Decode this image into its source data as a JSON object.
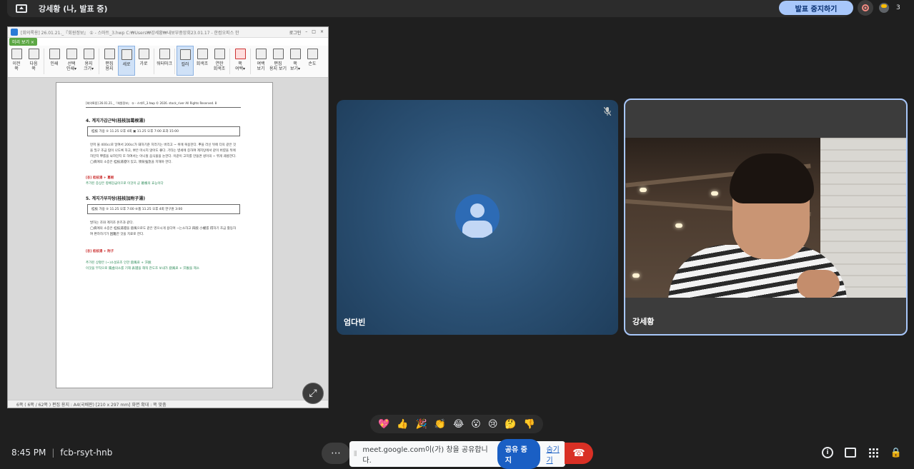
{
  "presentation_bar": {
    "title": "강세황 (나, 발표 중)",
    "stop_presenting_label": "발표 중지하기",
    "participant_count": "3"
  },
  "document_window": {
    "title_text": "[회의록용] 26.01.21._『회원정보』 ① - 스마트_3.hwp C:₩Users₩강세황₩내보부중앙회23.01.17 - 한컴오피스 한",
    "login_label": "로그인",
    "preview_tab": "미리 보기 ×",
    "toolbar": [
      {
        "label": "이전\n쪽",
        "sel": false
      },
      {
        "label": "다음\n쪽",
        "sel": false
      },
      {
        "label": "인쇄",
        "sel": false
      },
      {
        "label": "선택\n인쇄▾",
        "sel": false
      },
      {
        "label": "용지\n크기▾",
        "sel": false
      },
      {
        "label": "편집\n용지",
        "sel": false
      },
      {
        "label": "세로",
        "sel": true
      },
      {
        "label": "가로",
        "sel": false
      },
      {
        "label": "워터마크",
        "sel": false
      },
      {
        "label": "컬러",
        "sel": true
      },
      {
        "label": "회색조",
        "sel": false
      },
      {
        "label": "연한\n회색조",
        "sel": false
      },
      {
        "label": "쪽\n여백▾",
        "sel": false
      },
      {
        "label": "여백\n보기",
        "sel": false
      },
      {
        "label": "편집\n용지 보기",
        "sel": false
      },
      {
        "label": "쪽\n보기▾",
        "sel": false
      },
      {
        "label": "손도",
        "sel": false
      }
    ],
    "page": {
      "header": "[회의록용] 26.01.21._『회원정보』 ① - 스마트_3.hwp  © 2026. stock_river All Rights Reserved.      8",
      "section4_title": "4. 계지가감근탁(桂枝加葛根湯)",
      "section4_box": "桂枝 가용  ⑤ 11.25 오후 4회 ▣ 11.25 오후 7:00 효과 15:00",
      "section4_para": "먼저 물 400cc로 달여서 200cc가 돼하기준 치러기는 버리고 ~ 위에 복용한다. 뿌을 러신 뒤에 더욱 같은 것을 밀구 조금 땀이 나도록 하고, 뽀은 마시지 않아도 좋다. 기타는 병세에 증하여 계지탕에서 같이 버렸을 뒤에하던지 뿌를을 놔하던지 또 하여서는 아니될 음식물을 논한다. 이같이 고치를 만들면 냉이의 ~ 뛰게 궤롱한다.\n  ◯病에의 소증은 桂枝湯證이 있고, 項背強急을 치해야 한다.",
      "section4_note_label": "[용] 桂枝湯 + 葛根",
      "section4_note_text": "추가된 증상은 항배강급이므로 이것이 곧 葛根의 효능이다",
      "section5_title": "5. 계지가부자탕(桂枝加附子湯)",
      "section5_box": "桂枝 가용 ⑤ 11.25 오후 7:00 ⑥품 11.25 오후 4회 한구원 3:00",
      "section5_para": "발하는 조와 계지조 온즈과 같다.\n  ◯病에의 소증은 桂枝湯證을 惡風으로도 같은 영으시게 용다며 ~는소하고 四肢 小權를 得하기 조금 활동하여 편하하기가 困難한 것을 치료로 한다.",
      "section5_note_label": "[용] 桂枝湯 + 附子",
      "section5_note_text": "추가된 상황은 (~)소설효조 인한 惡風료 + 汗脫\n이것을 부작으로 陽虛의소를 기해 表證을 해적 관도조 보내가 惡風료 + 汗脫을 제소"
    },
    "status_bar": "6쪽 ( 6쪽 / 62쪽 )  편집 용지 : A4(국배판)  [210 x 297 mm]  화면 확대 : 쪽 맞춤"
  },
  "tiles": [
    {
      "name": "엄다빈",
      "mic_muted": true
    },
    {
      "name": "강세황",
      "active_speaker": true
    }
  ],
  "reactions": [
    "💖",
    "👍",
    "🎉",
    "👏",
    "😂",
    "😮",
    "😢",
    "🤔",
    "👎"
  ],
  "bottom_bar": {
    "time": "8:45 PM",
    "meeting_code": "fcb-rsyt-hnb",
    "more_label": "⋯",
    "share_message": "meet.google.com이(가) 창을 공유합니다.",
    "stop_share_label": "공유 중지",
    "hide_label": "숨기기"
  },
  "colors": {
    "background": "#1f1f1f",
    "stop_present_bg": "#a8c7fa",
    "hangup": "#d93025",
    "stop_share_bg": "#1a5fc4"
  }
}
